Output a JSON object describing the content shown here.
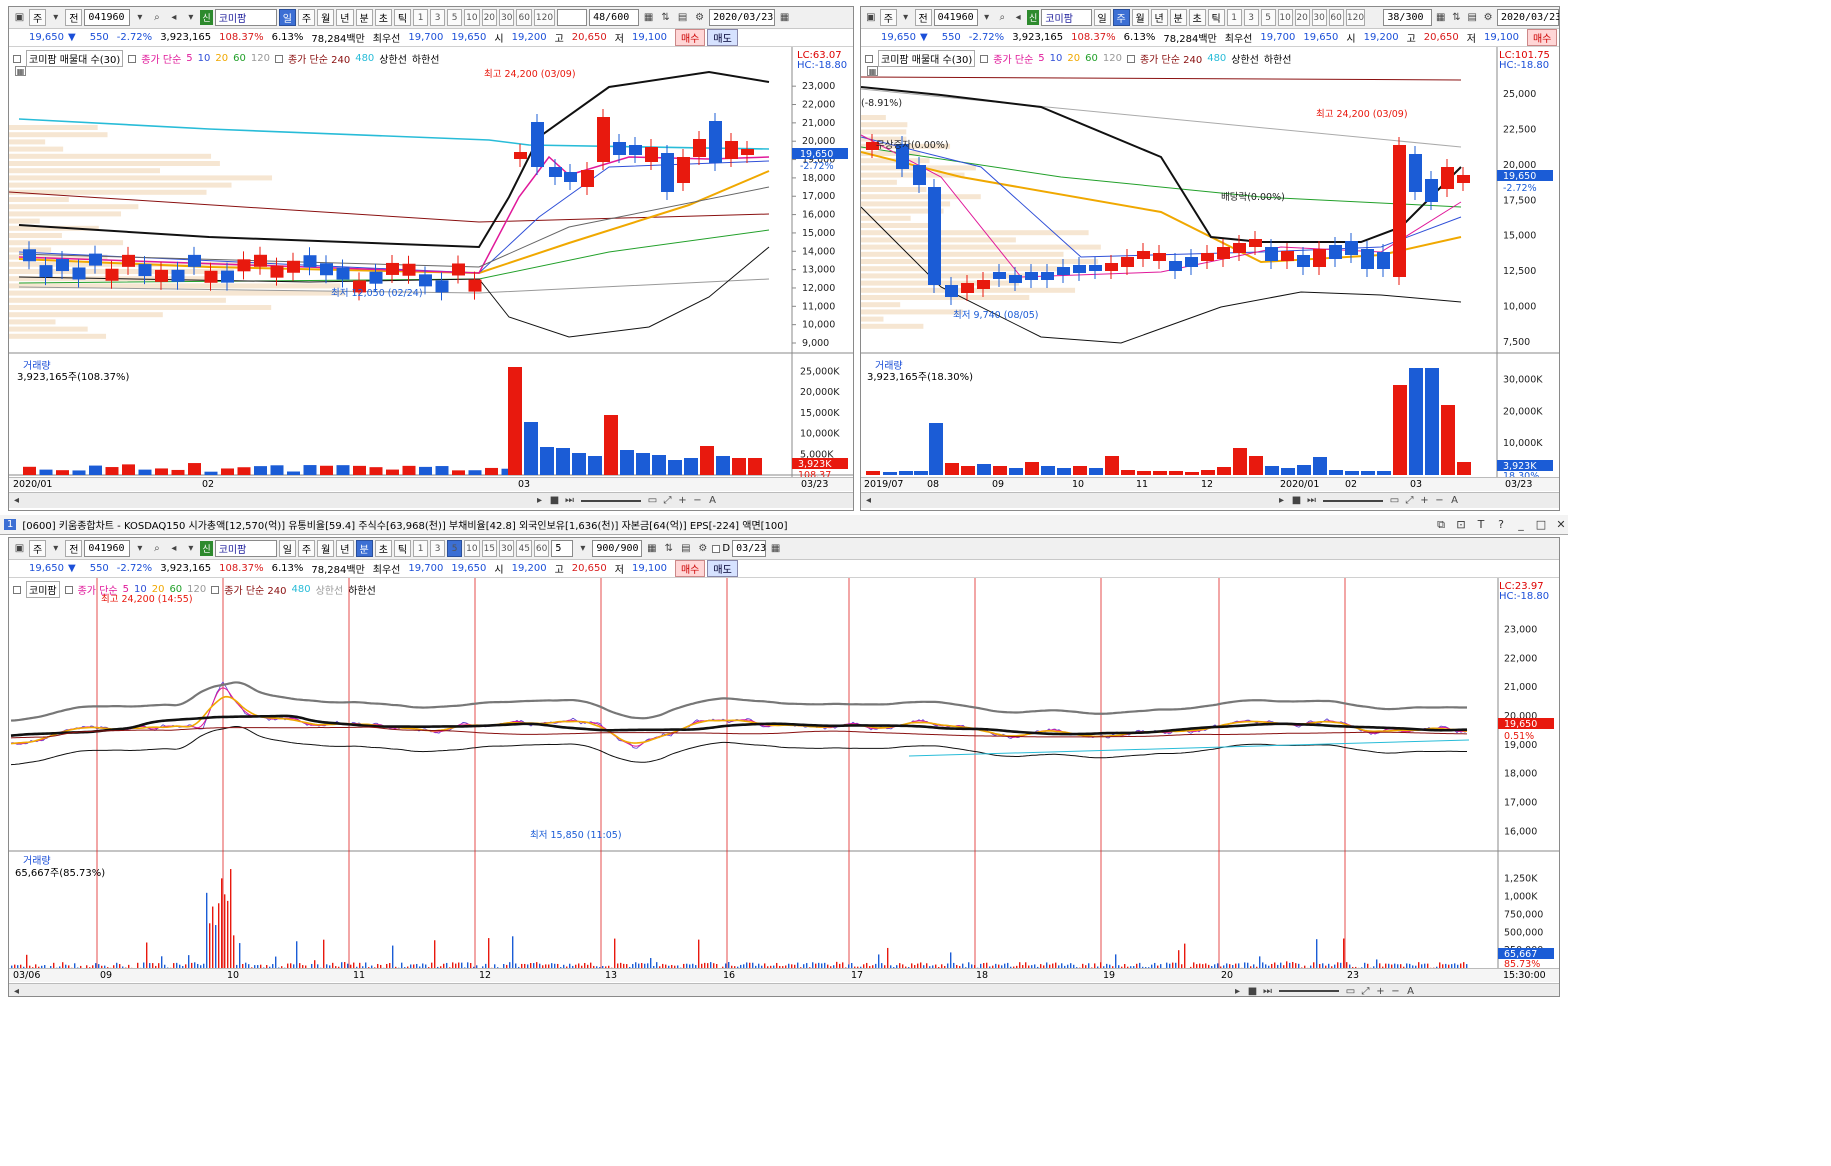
{
  "stock": {
    "code": "041960",
    "name": "코미팜",
    "tag": "신",
    "quote": {
      "price": "19,650",
      "change": "550",
      "change_pct": "-2.72%",
      "volume": "3,923,165",
      "vol_ratio": "108.37%",
      "turnover": "6.13%",
      "amount": "78,284백만",
      "pref_label": "최우선",
      "ask": "19,700",
      "bid": "19,650",
      "open_label": "시",
      "open": "19,200",
      "high_label": "고",
      "high": "20,650",
      "low_label": "저",
      "low": "19,100",
      "buy_label": "매수",
      "sell_label": "매도"
    }
  },
  "toolbar": {
    "type_label": "주",
    "prev_label": "전",
    "period_daily": "일",
    "period_weekly": "주",
    "period_monthly": "월",
    "period_yearly": "년",
    "period_min": "분",
    "period_sec": "초",
    "period_tick": "틱",
    "num_buttons": [
      "1",
      "3",
      "5",
      "10",
      "20",
      "30",
      "60",
      "120"
    ],
    "num_buttons_min": [
      "1",
      "3",
      "5",
      "10",
      "15",
      "30",
      "45",
      "60"
    ]
  },
  "colors": {
    "up": "#e8190e",
    "down": "#1b5cd6",
    "ma5": "#e0199a",
    "ma10": "#3050d8",
    "ma20": "#f0a800",
    "ma60": "#22a02a",
    "ma120": "#999999",
    "ma240": "#8a1010",
    "ma480": "#28bcd8"
  },
  "chart_left": {
    "count": "48/600",
    "date": "2020/03/23",
    "legend": {
      "main": "코미팜 매물대 수(30)",
      "ma_price": "종가 단순",
      "ma_nums": [
        "5",
        "10",
        "20",
        "60",
        "120"
      ],
      "ma_price2": "종가 단순 240",
      "ma480": "480",
      "upper": "상한선",
      "lower": "하한선"
    },
    "lc": "LC:63.07",
    "hc": "HC:-18.80",
    "yticks": [
      "23,000",
      "22,000",
      "21,000",
      "20,000",
      "19,000",
      "18,000",
      "17,000",
      "16,000",
      "15,000",
      "14,000",
      "13,000",
      "12,000",
      "11,000",
      "10,000",
      "9,000"
    ],
    "price_box": "19,650",
    "price_box2": "-2.72%",
    "high_note": "최고 24,200 (03/09)",
    "low_note": "최저 12,050 (02/24)",
    "vol_title": "거래량",
    "vol_value": "3,923,165주(108.37%)",
    "vol_yticks": [
      "25,000K",
      "20,000K",
      "15,000K",
      "10,000K",
      "5,000K"
    ],
    "vol_box": "3,923K",
    "vol_box2": "108.37",
    "xlabels": [
      "2020/01",
      "02",
      "03",
      "03/23"
    ]
  },
  "chart_right": {
    "count": "38/300",
    "date": "2020/03/23",
    "legend": {
      "main": "코미팜 매물대 수(30)",
      "ma_price": "종가 단순",
      "ma_nums": [
        "5",
        "10",
        "20",
        "60",
        "120"
      ],
      "ma_price2": "종가 단순 240",
      "ma480": "480",
      "upper": "상한선",
      "lower": "하한선"
    },
    "lc": "LC:101.75",
    "hc": "HC:-18.80",
    "yticks": [
      "25,000",
      "22,500",
      "20,000",
      "17,500",
      "15,000",
      "12,500",
      "10,000",
      "7,500"
    ],
    "price_box": "19,650",
    "price_box2": "-2.72%",
    "high_note": "최고 24,200 (03/09)",
    "low_note": "최저 9,740 (08/05)",
    "note1": "(-8.91%)",
    "note2": "무상증자(0.00%)",
    "note3": "배당락(0.00%)",
    "vol_title": "거래량",
    "vol_value": "3,923,165주(18.30%)",
    "vol_yticks": [
      "30,000K",
      "20,000K",
      "10,000K"
    ],
    "vol_box": "3,923K",
    "vol_box2": "18.30%",
    "xlabels": [
      "2019/07",
      "08",
      "09",
      "10",
      "11",
      "12",
      "2020/01",
      "02",
      "03",
      "03/23"
    ]
  },
  "window_title": {
    "num": "1",
    "text": "[0600] 키움종합차트 - KOSDAQ150 시가총액[12,570(억)] 유통비율[59.4] 주식수[63,968(천)] 부채비율[42.8] 외국인보유[1,636(천)] 자본금[64(억)] EPS[-224] 액면[100]"
  },
  "chart_bottom": {
    "min_value": "5",
    "count": "900/900",
    "date": "03/23",
    "d_label": "D",
    "legend": {
      "main": "코미팜",
      "ma_price": "종가 단순",
      "ma_nums": [
        "5",
        "10",
        "20",
        "60",
        "120"
      ],
      "ma_price2": "종가 단순 240",
      "ma480": "480",
      "upper": "상한선",
      "lower": "하한선"
    },
    "lc": "LC:23.97",
    "hc": "HC:-18.80",
    "yticks": [
      "23,000",
      "22,000",
      "21,000",
      "20,000",
      "19,000",
      "18,000",
      "17,000",
      "16,000"
    ],
    "price_box": "19,650",
    "price_box2": "0.51%",
    "high_note": "최고 24,200 (14:55)",
    "low_note": "최저 15,850 (11:05)",
    "vol_title": "거래량",
    "vol_value": "65,667주(85.73%)",
    "vol_yticks": [
      "1,250K",
      "1,000K",
      "750,000",
      "500,000",
      "250,000"
    ],
    "vol_box": "65,667",
    "vol_box2": "85.73%",
    "xlabels": [
      "03/06",
      "09",
      "10",
      "11",
      "12",
      "13",
      "16",
      "17",
      "18",
      "19",
      "20",
      "23",
      "15:30:00"
    ]
  }
}
